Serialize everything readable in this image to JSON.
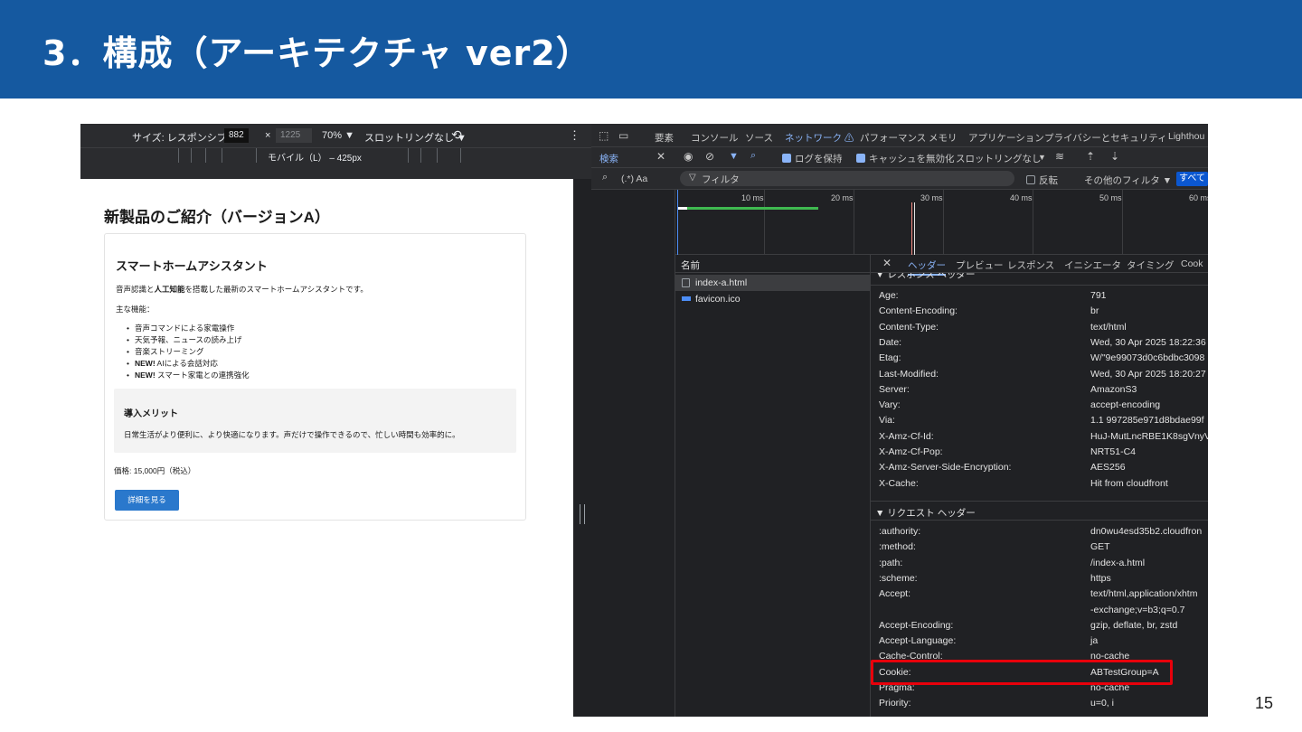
{
  "slide": {
    "title": "3．構成（アーキテクチャ ver2）",
    "page_number": "15"
  },
  "emulator": {
    "size_label": "サイズ: レスポンシブ ▼",
    "width": "882",
    "height": "1225",
    "zoom": "70% ▼",
    "throttle": "スロットリングなし ▼",
    "device_label": "モバイル（L） – 425px"
  },
  "page": {
    "h1": "新製品のご紹介（バージョンA）",
    "product": "スマートホームアシスタント",
    "desc_pre": "音声認識と",
    "desc_bold": "人工知能",
    "desc_post": "を搭載した最新のスマートホームアシスタントです。",
    "features_label": "主な機能：",
    "features": [
      {
        "bold": "",
        "text": "音声コマンドによる家電操作"
      },
      {
        "bold": "",
        "text": "天気予報、ニュースの読み上げ"
      },
      {
        "bold": "",
        "text": "音楽ストリーミング"
      },
      {
        "bold": "NEW!",
        "text": " AIによる会話対応"
      },
      {
        "bold": "NEW!",
        "text": " スマート家電との連携強化"
      }
    ],
    "merit_title": "導入メリット",
    "merit_text": "日常生活がより便利に、より快適になります。声だけで操作できるので、忙しい時間も効率的に。",
    "price": "価格: 15,000円（税込）",
    "button": "詳細を見る"
  },
  "devtools": {
    "tabs": [
      "要素",
      "コンソール",
      "ソース",
      "ネットワーク ⚠",
      "パフォーマンス",
      "メモリ",
      "アプリケーション",
      "プライバシーとセキュリティ",
      "Lighthou"
    ],
    "active_tab": "ネットワーク ⚠",
    "search_tab": "検索",
    "preserve_log": "ログを保持",
    "disable_cache": "キャッシュを無効化",
    "throttle": "スロットリングなし",
    "search_options": "(.*)  Aa",
    "filter_placeholder": "フィルタ",
    "invert": "反転",
    "other_filters": "その他のフィルタ ▼",
    "all": "すべて",
    "timeline_ticks": [
      "10 ms",
      "20 ms",
      "30 ms",
      "40 ms",
      "50 ms",
      "60 ms"
    ],
    "names_header": "名前",
    "files": [
      "index-a.html",
      "favicon.ico"
    ],
    "detail_tabs": [
      "ヘッダー",
      "プレビュー",
      "レスポンス",
      "イニシエータ",
      "タイミング",
      "Cook"
    ],
    "response_section": "▼ レスポンス ヘッダー",
    "response_headers": [
      {
        "k": "Age:",
        "v": "791"
      },
      {
        "k": "Content-Encoding:",
        "v": "br"
      },
      {
        "k": "Content-Type:",
        "v": "text/html"
      },
      {
        "k": "Date:",
        "v": "Wed, 30 Apr 2025 18:22:36"
      },
      {
        "k": "Etag:",
        "v": "W/\"9e99073d0c6bdbc3098"
      },
      {
        "k": "Last-Modified:",
        "v": "Wed, 30 Apr 2025 18:20:27"
      },
      {
        "k": "Server:",
        "v": "AmazonS3"
      },
      {
        "k": "Vary:",
        "v": "accept-encoding"
      },
      {
        "k": "Via:",
        "v": "1.1 997285e971d8bdae99f"
      },
      {
        "k": "X-Amz-Cf-Id:",
        "v": "HuJ-MutLncRBE1K8sgVnyV"
      },
      {
        "k": "X-Amz-Cf-Pop:",
        "v": "NRT51-C4"
      },
      {
        "k": "X-Amz-Server-Side-Encryption:",
        "v": "AES256"
      },
      {
        "k": "X-Cache:",
        "v": "Hit from cloudfront"
      }
    ],
    "request_section": "▼ リクエスト ヘッダー",
    "request_headers": [
      {
        "k": ":authority:",
        "v": "dn0wu4esd35b2.cloudfron"
      },
      {
        "k": ":method:",
        "v": "GET"
      },
      {
        "k": ":path:",
        "v": "/index-a.html"
      },
      {
        "k": ":scheme:",
        "v": "https"
      },
      {
        "k": "Accept:",
        "v": "text/html,application/xhtm"
      },
      {
        "k": "",
        "v": "-exchange;v=b3;q=0.7"
      },
      {
        "k": "Accept-Encoding:",
        "v": "gzip, deflate, br, zstd"
      },
      {
        "k": "Accept-Language:",
        "v": "ja"
      },
      {
        "k": "Cache-Control:",
        "v": "no-cache"
      },
      {
        "k": "Cookie:",
        "v": "ABTestGroup=A"
      },
      {
        "k": "Pragma:",
        "v": "no-cache"
      },
      {
        "k": "Priority:",
        "v": "u=0, i"
      }
    ]
  },
  "colors": {
    "banner": "#1559a0",
    "highlight": "#e8000b",
    "accent": "#8ab4f8",
    "button": "#2a78cc"
  }
}
